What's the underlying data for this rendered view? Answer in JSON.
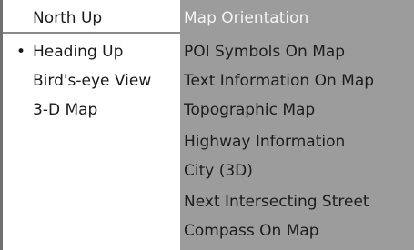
{
  "orientation_menu": {
    "items": [
      {
        "label": "North Up",
        "selected": false,
        "highlighted": true
      },
      {
        "label": "Heading Up",
        "selected": true,
        "bullet": "•"
      },
      {
        "label": "Bird's-eye View",
        "selected": false
      },
      {
        "label": "3-D Map",
        "selected": false
      }
    ]
  },
  "map_options_menu": {
    "title": "Map Orientation",
    "items": [
      {
        "label": "POI Symbols On Map"
      },
      {
        "label": "Text Information On Map"
      },
      {
        "label": "Topographic Map"
      },
      {
        "label": "Highway Information"
      },
      {
        "label": "City (3D)"
      },
      {
        "label": "Next Intersecting Street"
      },
      {
        "label": "Compass On Map"
      }
    ]
  },
  "colors": {
    "left_background": "#ffffff",
    "right_background": "#9c9c9c",
    "title_text": "#f4f4f4",
    "item_text": "#1c1c1c"
  }
}
